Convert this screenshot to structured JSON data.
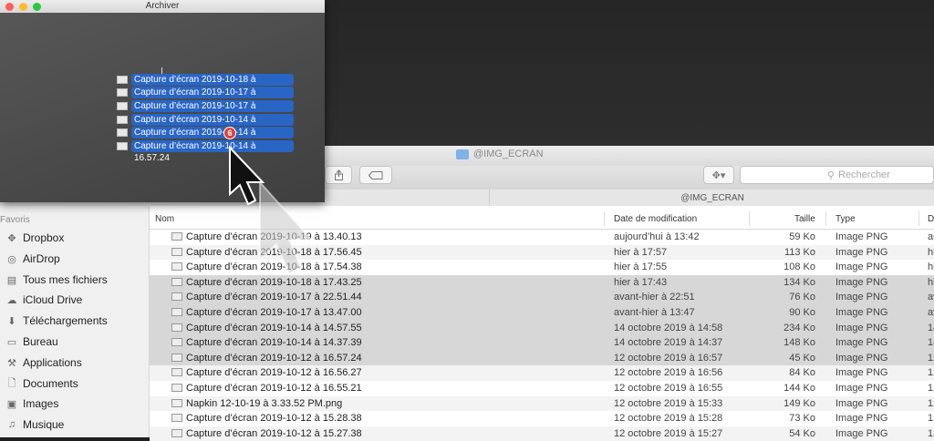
{
  "archiver": {
    "title": "Archiver",
    "traffic_lights": [
      "#fc5f57",
      "#fdbc2e",
      "#28c840"
    ],
    "dragged_items": [
      "Capture d’écran 2019-10-18 à 17.43.25",
      "Capture d’écran 2019-10-17 à 22.51.44",
      "Capture d’écran 2019-10-17 à 13.47.00",
      "Capture d’écran 2019-10-14 à 14.57.55",
      "Capture d’écran 2019-10-14 à 14.37.39",
      "Capture d’écran 2019-10-14 à 16.57.24"
    ],
    "drag_count": "6"
  },
  "finder": {
    "title": "@IMG_ECRAN",
    "path_label": "@IMG_ECRAN",
    "search_placeholder": "Rechercher",
    "columns": {
      "name": "Nom",
      "date": "Date de modification",
      "size": "Taille",
      "type": "Type",
      "extra": "D"
    },
    "sidebar": {
      "section": "Favoris",
      "items": [
        {
          "label": "Dropbox",
          "icon": "dropbox-icon"
        },
        {
          "label": "AirDrop",
          "icon": "airdrop-icon"
        },
        {
          "label": "Tous mes fichiers",
          "icon": "all-files-icon"
        },
        {
          "label": "iCloud Drive",
          "icon": "cloud-icon"
        },
        {
          "label": "Téléchargements",
          "icon": "download-icon"
        },
        {
          "label": "Bureau",
          "icon": "desktop-icon"
        },
        {
          "label": "Applications",
          "icon": "applications-icon"
        },
        {
          "label": "Documents",
          "icon": "documents-icon"
        },
        {
          "label": "Images",
          "icon": "images-icon"
        },
        {
          "label": "Musique",
          "icon": "music-icon"
        }
      ]
    },
    "rows": [
      {
        "name": "Capture d’écran 2019-10-19 à 13.40.13",
        "date": "aujourd’hui à 13:42",
        "size": "59 Ko",
        "type": "Image PNG",
        "extra": "au",
        "selected": false
      },
      {
        "name": "Capture d’écran 2019-10-18 à 17.56.45",
        "date": "hier à 17:57",
        "size": "113 Ko",
        "type": "Image PNG",
        "extra": "hi",
        "selected": false
      },
      {
        "name": "Capture d’écran 2019-10-18 à 17.54.38",
        "date": "hier à 17:55",
        "size": "108 Ko",
        "type": "Image PNG",
        "extra": "hi",
        "selected": false
      },
      {
        "name": "Capture d’écran 2019-10-18 à 17.43.25",
        "date": "hier à 17:43",
        "size": "134 Ko",
        "type": "Image PNG",
        "extra": "hi",
        "selected": true
      },
      {
        "name": "Capture d’écran 2019-10-17 à 22.51.44",
        "date": "avant-hier à 22:51",
        "size": "76 Ko",
        "type": "Image PNG",
        "extra": "av",
        "selected": true
      },
      {
        "name": "Capture d’écran 2019-10-17 à 13.47.00",
        "date": "avant-hier à 13:47",
        "size": "90 Ko",
        "type": "Image PNG",
        "extra": "av",
        "selected": true
      },
      {
        "name": "Capture d’écran 2019-10-14 à 14.57.55",
        "date": "14 octobre 2019 à 14:58",
        "size": "234 Ko",
        "type": "Image PNG",
        "extra": "14",
        "selected": true
      },
      {
        "name": "Capture d’écran 2019-10-14 à 14.37.39",
        "date": "14 octobre 2019 à 14:37",
        "size": "148 Ko",
        "type": "Image PNG",
        "extra": "14",
        "selected": true
      },
      {
        "name": "Capture d’écran 2019-10-12 à 16.57.24",
        "date": "12 octobre 2019 à 16:57",
        "size": "45 Ko",
        "type": "Image PNG",
        "extra": "12",
        "selected": true
      },
      {
        "name": "Capture d’écran 2019-10-12 à 16.56.27",
        "date": "12 octobre 2019 à 16:56",
        "size": "84 Ko",
        "type": "Image PNG",
        "extra": "12",
        "selected": false
      },
      {
        "name": "Capture d’écran 2019-10-12 à 16.55.21",
        "date": "12 octobre 2019 à 16:55",
        "size": "144 Ko",
        "type": "Image PNG",
        "extra": "12",
        "selected": false
      },
      {
        "name": "Napkin 12-10-19 à 3.33.52 PM.png",
        "date": "12 octobre 2019 à 15:33",
        "size": "149 Ko",
        "type": "Image PNG",
        "extra": "12",
        "selected": false
      },
      {
        "name": "Capture d’écran 2019-10-12 à 15.28.38",
        "date": "12 octobre 2019 à 15:28",
        "size": "73 Ko",
        "type": "Image PNG",
        "extra": "12",
        "selected": false
      },
      {
        "name": "Capture d’écran 2019-10-12 à 15.27.38",
        "date": "12 octobre 2019 à 15:27",
        "size": "54 Ko",
        "type": "Image PNG",
        "extra": "12",
        "selected": false
      }
    ]
  }
}
